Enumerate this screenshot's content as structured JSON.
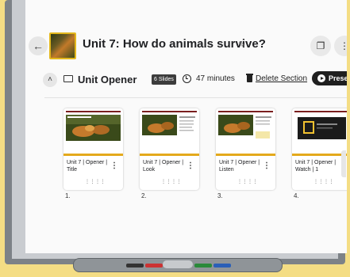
{
  "header": {
    "back_icon": "arrow-left-icon",
    "title": "Unit 7: How do animals survive?",
    "edit_icon": "pencil-icon",
    "copy_icon": "copy-icon",
    "more_icon": "more-vertical-icon"
  },
  "section": {
    "collapse_icon": "chevron-up-icon",
    "title": "Unit Opener",
    "slides_badge": "6 Slides",
    "duration": "47 minutes",
    "delete_label": "Delete Section",
    "present_label": "Present"
  },
  "slides": [
    {
      "label": "Unit 7 | Opener | Title",
      "number": "1."
    },
    {
      "label": "Unit 7 | Opener | Look",
      "number": "2."
    },
    {
      "label": "Unit 7 | Opener | Listen",
      "number": "3."
    },
    {
      "label": "Unit 7 | Opener | Watch | 1",
      "number": "4."
    }
  ],
  "colors": {
    "accent_bar": "#e4a91c",
    "present_button": "#1f1f1f",
    "background": "#f4dd84"
  }
}
